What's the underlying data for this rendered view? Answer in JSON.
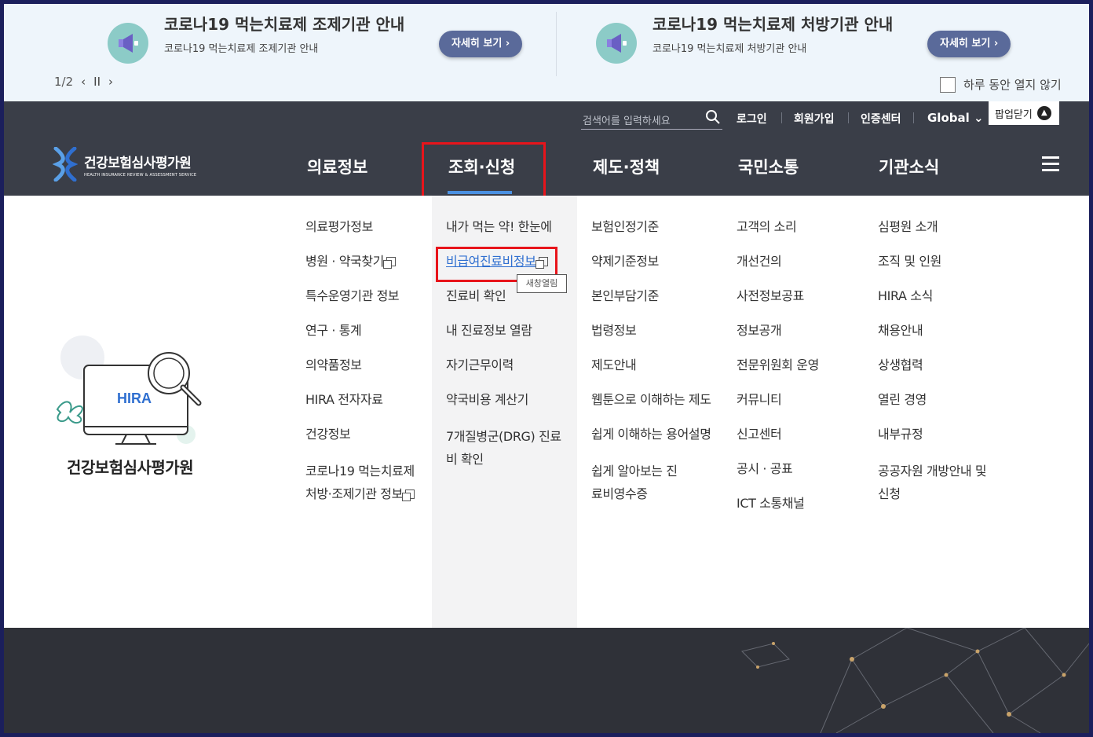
{
  "popup": {
    "items": [
      {
        "title": "코로나19 먹는치료제 조제기관 안내",
        "subtitle": "코로나19 먹는치료제 조제기관 안내",
        "more_label": "자세히 보기 ›"
      },
      {
        "title": "코로나19 먹는치료제 처방기관 안내",
        "subtitle": "코로나19 먹는치료제 처방기관 안내",
        "more_label": "자세히 보기 ›"
      }
    ],
    "pager": {
      "current": "1",
      "sep": "/",
      "total": "2",
      "prev": "‹",
      "pause": "II",
      "next": "›"
    },
    "not_today_label": "하루 동안 열지 않기",
    "close_label": "팝업닫기"
  },
  "header": {
    "search_placeholder": "검색어를 입력하세요",
    "util": {
      "login": "로그인",
      "join": "회원가입",
      "cert": "인증센터",
      "global": "Global ⌄"
    },
    "logo": {
      "name": "건강보험심사평가원",
      "eng": "HEALTH INSURANCE REVIEW & ASSESSMENT SERVICE"
    },
    "nav": [
      "의료정보",
      "조회·신청",
      "제도·정책",
      "국민소통",
      "기관소식"
    ]
  },
  "menu": {
    "col1": [
      "의료평가정보",
      "병원 · 약국찾기",
      "특수운영기관 정보",
      "연구 · 통계",
      "의약품정보",
      "HIRA 전자자료",
      "건강정보",
      "코로나19 먹는치료제 처방·조제기관 정보"
    ],
    "col2": [
      "내가 먹는 약! 한눈에",
      "비급여진료비정보",
      "진료비 확인",
      "내 진료정보 열람",
      "자기근무이력",
      "약국비용 계산기",
      "7개질병군(DRG) 진료비 확인"
    ],
    "col3": [
      "보험인정기준",
      "약제기준정보",
      "본인부담기준",
      "법령정보",
      "제도안내",
      "웹툰으로 이해하는 제도",
      "쉽게 이해하는 용어설명",
      "쉽게 알아보는 진료비영수증"
    ],
    "col4": [
      "고객의 소리",
      "개선건의",
      "사전정보공표",
      "정보공개",
      "전문위원회 운영",
      "커뮤니티",
      "신고센터",
      "공시 · 공표",
      "ICT 소통채널"
    ],
    "col5": [
      "심평원 소개",
      "조직 및 인원",
      "HIRA 소식",
      "채용안내",
      "상생협력",
      "열린 경영",
      "내부규정",
      "공공자원 개방안내 및 신청"
    ],
    "tooltip": "새창열림",
    "side_title": "건강보험심사평가원",
    "side_art_label": "HIRA"
  },
  "colors": {
    "accent": "#4a90e2",
    "highlight": "#e8141b",
    "header_bg": "#3a3e48",
    "popup_bg": "#eef5fb"
  }
}
